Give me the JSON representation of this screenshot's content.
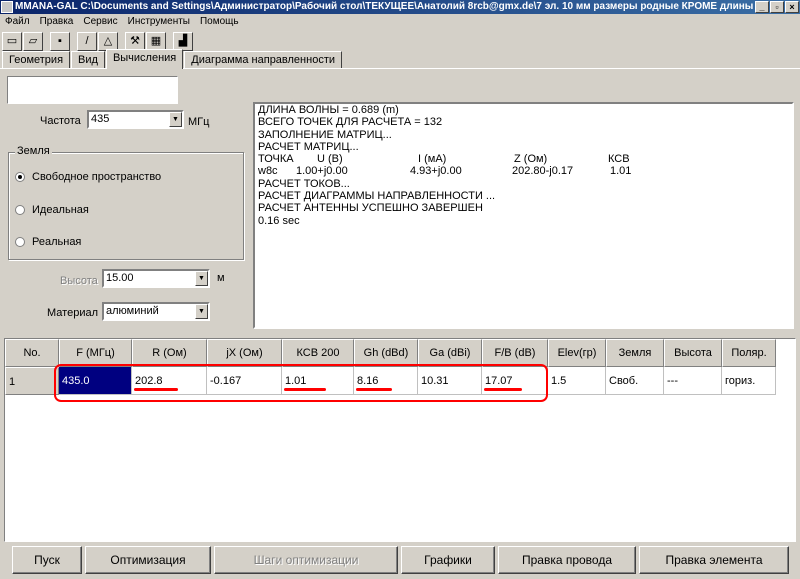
{
  "window": {
    "title": "MMANA-GAL C:\\Documents and Settings\\Администратор\\Рабочий стол\\ТЕКУЩЕЕ\\Анатолий 8rcb@gmx.de\\7 эл. 10 мм размеры родные КРОМЕ длины W и р...",
    "minimize": "_",
    "restore": "▫",
    "close": "×"
  },
  "menu": [
    "Файл",
    "Правка",
    "Сервис",
    "Инструменты",
    "Помощь"
  ],
  "toolbar": {
    "new": "▭",
    "open": "▱",
    "save": "▪",
    "line": "/",
    "triangle": "△",
    "tools": "⚒",
    "calc": "▦",
    "exec": "▟"
  },
  "tabs": [
    "Геометрия",
    "Вид",
    "Вычисления",
    "Диаграмма направленности"
  ],
  "form": {
    "freq_label": "Частота",
    "freq_value": "435",
    "freq_unit": "МГц",
    "ground_legend": "Земля",
    "ground_options": [
      "Свободное пространство",
      "Идеальная",
      "Реальная"
    ],
    "ground_selected": "Свободное пространство",
    "height_label": "Высота",
    "height_value": "15.00",
    "height_unit": "м",
    "material_label": "Материал",
    "material_value": "алюминий"
  },
  "output": {
    "lines": [
      "ДЛИНА ВОЛНЫ = 0.689 (m)",
      "ВСЕГО ТОЧЕК ДЛЯ РАСЧЕТА = 132",
      "ЗАПОЛНЕНИЕ МАТРИЦ...",
      "РАСЧЕТ МАТРИЦ..."
    ],
    "table_header": [
      "ТОЧКА",
      "U (B)",
      "I (мА)",
      "Z (Ом)",
      "КСВ"
    ],
    "table_row": [
      "w8c",
      "1.00+j0.00",
      "4.93+j0.00",
      "202.80-j0.17",
      "1.01"
    ],
    "lines_after": [
      "РАСЧЕТ ТОКОВ...",
      "РАСЧЕТ ДИАГРАММЫ НАПРАВЛЕННОСТИ ...",
      "РАСЧЕТ АНТЕННЫ УСПЕШНО ЗАВЕРШЕН",
      "0.16 sec"
    ]
  },
  "results": {
    "columns": [
      "No.",
      "F (МГц)",
      "R (Ом)",
      "jX (Ом)",
      "КСВ 200",
      "Gh (dBd)",
      "Ga (dBi)",
      "F/B (dB)",
      "Elev(гр)",
      "Земля",
      "Высота",
      "Поляр."
    ],
    "rows": [
      [
        "1",
        "435.0",
        "202.8",
        "-0.167",
        "1.01",
        "8.16",
        "10.31",
        "17.07",
        "1.5",
        "Своб.",
        "---",
        "гориз."
      ]
    ]
  },
  "buttons": {
    "start": "Пуск",
    "optimize": "Оптимизация",
    "opt_steps": "Шаги оптимизации",
    "graphs": "Графики",
    "edit_wire": "Правка провода",
    "edit_element": "Правка элемента"
  },
  "colors": {
    "face": "#d4d0c8",
    "title_blue": "#0a246a",
    "selection": "#000080",
    "annotation": "#ff0000"
  }
}
